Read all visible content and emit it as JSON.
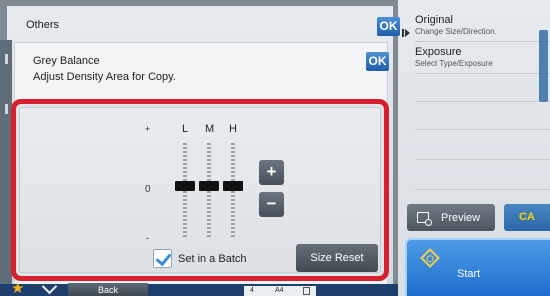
{
  "right_panel": {
    "items": [
      {
        "title": "Original",
        "subtitle": "Change Size/Direction."
      },
      {
        "title": "Exposure",
        "subtitle": "Select Type/Exposure"
      }
    ],
    "preview_label": "Preview",
    "ca_label": "CA",
    "start_label": "Start"
  },
  "dialog": {
    "outer_title": "Others",
    "ok_label": "OK",
    "inner_title": "Grey Balance",
    "inner_subtitle": "Adjust Density Area for Copy."
  },
  "grey_balance": {
    "scale_plus": "+",
    "scale_zero": "0",
    "scale_minus": "-",
    "channels": [
      {
        "label": "L",
        "level": 0
      },
      {
        "label": "M",
        "level": 0
      },
      {
        "label": "H",
        "level": 0
      }
    ],
    "increase_label": "+",
    "decrease_label": "−",
    "batch_label": "Set in a Batch",
    "batch_checked": true,
    "size_reset_label": "Size Reset"
  },
  "bottom_bar": {
    "back_label": "Back",
    "copies": "4",
    "paper": "A4"
  },
  "colors": {
    "highlight": "#d6202f",
    "ok_blue": "#2e6fbe",
    "ca_text": "#f5d400",
    "star": "#f3b318"
  }
}
